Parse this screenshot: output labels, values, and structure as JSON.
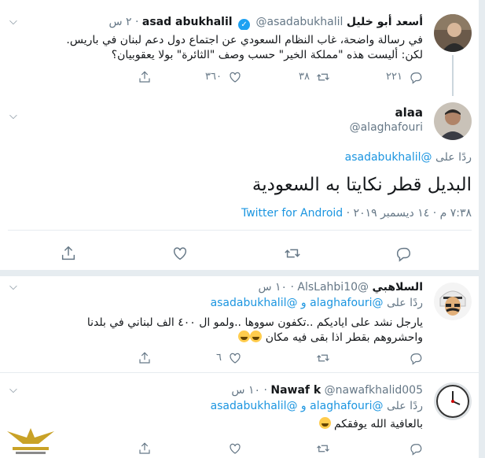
{
  "tweets": {
    "parent": {
      "name": "asad abukhalil",
      "name_ar": "أسعد أبو خليل",
      "handle": "@asadabukhalil",
      "time": "٢ س",
      "text_line1": "في رسالة واضحة، غاب النظام السعودي عن اجتماع دول دعم لبنان في باريس.",
      "text_line2": "لكن: أليست هذه \"مملكة الخير\" حسب وصف \"الثائرة\" بولا يعقوبيان؟",
      "replies": "٢٢١",
      "retweets": "٣٨",
      "likes": "٣٦٠"
    },
    "main": {
      "name": "alaa",
      "handle": "@alaghafouri",
      "reply_prefix": "ردًا على",
      "reply_handle": "@asadabukhalil",
      "text": "البديل قطر نكايتا به السعودية",
      "timestamp": "٧:٣٨ م · ١٤ ديسمبر ٢٠١٩",
      "source": "Twitter for Android"
    },
    "reply1": {
      "name": "السلاهبي",
      "handle": "@AlsLahbi10",
      "time": "١٠ س",
      "reply_prefix": "ردًا على",
      "reply_handle1": "@alaghafouri",
      "reply_and": "و",
      "reply_handle2": "@asadabukhalil",
      "text_line1": "يارجل نشد على اياديكم ..تكفون سووها ..ولمو ال ٤٠٠ الف لبناني في بلدنا",
      "text_line2": "واحشروهم بقطر اذا بقى فيه مكان",
      "likes": "٦"
    },
    "reply2": {
      "name": "Nawaf k",
      "handle": "@nawafkhalid005",
      "time": "١٠ س",
      "reply_prefix": "ردًا على",
      "reply_handle1": "@alaghafouri",
      "reply_and": "و",
      "reply_handle2": "@asadabukhalil",
      "text": "بالعافية الله يوفقكم"
    }
  },
  "colors": {
    "link": "#1b95e0",
    "muted": "#657786",
    "verified": "#1da1f2",
    "divider": "#e6ecf0"
  },
  "icons": [
    "reply-icon",
    "retweet-icon",
    "like-icon",
    "share-icon",
    "chevron-down-icon",
    "verified-icon"
  ]
}
